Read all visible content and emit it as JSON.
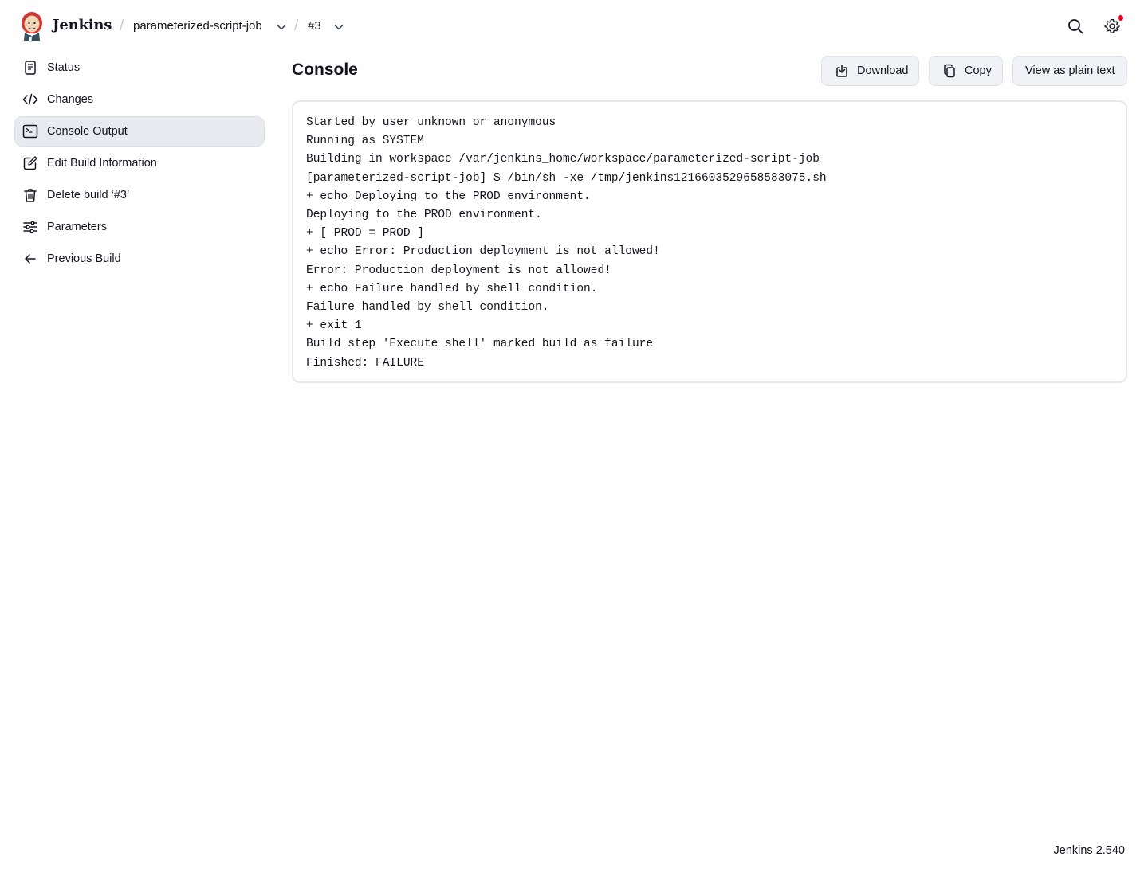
{
  "header": {
    "brand": "Jenkins",
    "breadcrumbs": [
      {
        "label": "parameterized-script-job"
      },
      {
        "label": "#3"
      }
    ],
    "search_icon": "search-icon",
    "settings_icon": "gear-icon",
    "notification_color": "#e6001f"
  },
  "sidebar": {
    "items": [
      {
        "label": "Status",
        "icon": "document-icon"
      },
      {
        "label": "Changes",
        "icon": "code-icon"
      },
      {
        "label": "Console Output",
        "icon": "terminal-icon",
        "active": true
      },
      {
        "label": "Edit Build Information",
        "icon": "edit-icon"
      },
      {
        "label": "Delete build ‘#3’",
        "icon": "trash-icon"
      },
      {
        "label": "Parameters",
        "icon": "sliders-icon"
      },
      {
        "label": "Previous Build",
        "icon": "arrow-left-icon"
      }
    ]
  },
  "main": {
    "title": "Console",
    "actions": {
      "download": "Download",
      "copy": "Copy",
      "plain_text": "View as plain text"
    },
    "console_lines": [
      "Started by user unknown or anonymous",
      "Running as SYSTEM",
      "Building in workspace /var/jenkins_home/workspace/parameterized-script-job",
      "[parameterized-script-job] $ /bin/sh -xe /tmp/jenkins1216603529658583075.sh",
      "+ echo Deploying to the PROD environment.",
      "Deploying to the PROD environment.",
      "+ [ PROD = PROD ]",
      "+ echo Error: Production deployment is not allowed!",
      "Error: Production deployment is not allowed!",
      "+ echo Failure handled by shell condition.",
      "Failure handled by shell condition.",
      "+ exit 1",
      "Build step 'Execute shell' marked build as failure",
      "Finished: FAILURE"
    ]
  },
  "footer": {
    "version": "Jenkins 2.540"
  }
}
